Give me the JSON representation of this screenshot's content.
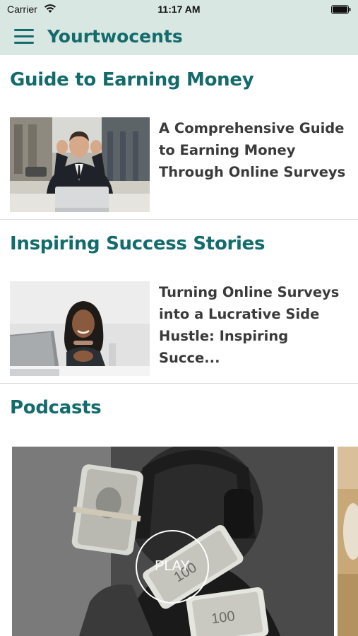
{
  "status_bar": {
    "carrier": "Carrier",
    "time": "11:17 AM"
  },
  "header": {
    "app_title": "Yourtwocents",
    "menu_icon": "hamburger-menu-icon"
  },
  "sections": [
    {
      "title": "Guide to Earning Money",
      "article": {
        "title": "A Comprehensive Guide to Earning Money Through Online Surveys",
        "image": "man-celebrating-at-laptop-photo"
      }
    },
    {
      "title": "Inspiring Success Stories",
      "article": {
        "title": "Turning Online Surveys into a Lucrative Side Hustle: Inspiring Succe...",
        "image": "smiling-woman-at-laptop-photo"
      }
    },
    {
      "title": "Podcasts"
    }
  ],
  "podcast": {
    "play_label": "PLAY",
    "image": "person-holding-money-rolls-photo"
  },
  "colors": {
    "accent": "#136b6b",
    "header_bg": "#d9e7e3",
    "article_text": "#3a3a3a"
  }
}
